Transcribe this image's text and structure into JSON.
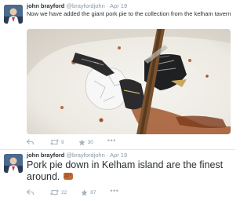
{
  "tweets": [
    {
      "name": "john brayford",
      "handle": "@brayfordjohn",
      "separator": "·",
      "date": "Apr 19",
      "text": "Now we have added the giant pork pie to the collection from the kelham tavern",
      "retweets": "9",
      "favorites": "30",
      "more": "•••",
      "media": "photo-of-torn-pork-pie-wrappers-on-plate"
    },
    {
      "name": "john brayford",
      "handle": "@brayfordjohn",
      "separator": "·",
      "date": "Apr 19",
      "text": "Pork pie down in Kelham island are the finest around.",
      "emoji_icon": "fist-bump-emoji",
      "retweets": "22",
      "favorites": "87",
      "more": "•••"
    }
  ],
  "colors": {
    "text": "#292f33",
    "muted": "#8899a6",
    "divider": "#e1e8ed"
  }
}
